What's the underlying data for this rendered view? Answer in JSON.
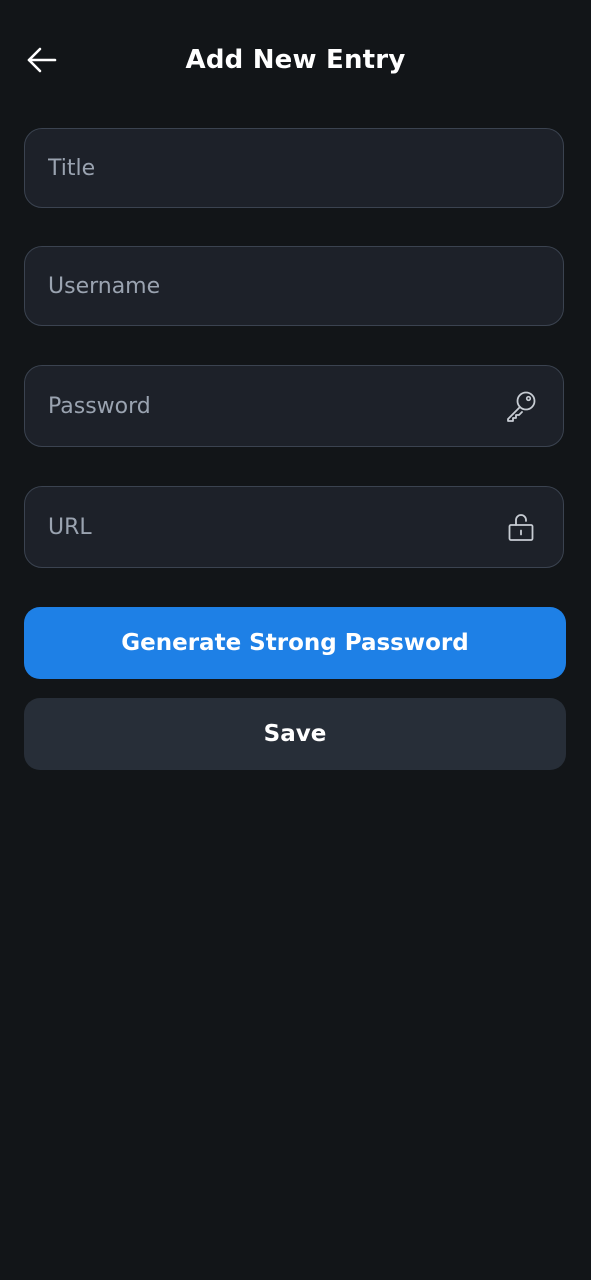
{
  "header": {
    "title": "Add New Entry",
    "back_icon": "arrow-left-icon"
  },
  "form": {
    "title_placeholder": "Title",
    "username_placeholder": "Username",
    "password_placeholder": "Password",
    "url_placeholder": "URL",
    "password_icon": "key-icon",
    "url_icon": "unlock-icon"
  },
  "actions": {
    "generate_label": "Generate Strong Password",
    "save_label": "Save"
  },
  "colors": {
    "background": "#121518",
    "field_background": "#1d2129",
    "field_border": "#3b4350",
    "primary": "#1e80e6",
    "secondary": "#272e38",
    "placeholder": "#9aa3b0"
  }
}
